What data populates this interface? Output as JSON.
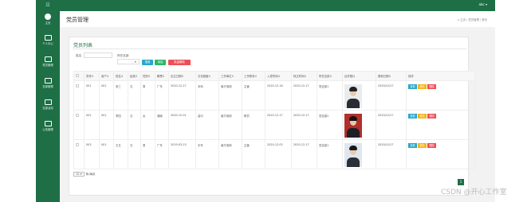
{
  "sidebar": {
    "logo": "☷",
    "items": [
      {
        "label": "主页",
        "icon": "home-icon"
      },
      {
        "label": "个人中心",
        "icon": "monitor-icon"
      },
      {
        "label": "党员管理",
        "icon": "monitor-icon"
      },
      {
        "label": "支部管理",
        "icon": "monitor-icon"
      },
      {
        "label": "支部活动",
        "icon": "monitor-icon"
      },
      {
        "label": "公告管理",
        "icon": "monitor-icon"
      }
    ]
  },
  "topbar": {
    "user": "abc ▾"
  },
  "header": {
    "title": "党员管理",
    "breadcrumb": "⌂ 主页  /  党员管理  /  首页"
  },
  "panel": {
    "title": "党员列表",
    "filters": {
      "name_label": "姓名",
      "branch_label": "所在支部",
      "select_value": "▾"
    },
    "buttons": {
      "search": "搜索",
      "add": "添加",
      "batch_delete": "批量删除"
    }
  },
  "table": {
    "headers": [
      "",
      "党号⇕",
      "用户⇕",
      "姓名⇕",
      "民族⇕",
      "性别⇕",
      "籍贯⇕",
      "出生日期⇕",
      "文化程度⇕",
      "工作单位⇕",
      "工作职务⇕",
      "入党时间⇕",
      "转正时间⇕",
      "所在支部⇕",
      "证件照片",
      "更新日期⇕",
      "操作"
    ],
    "rows": [
      {
        "cells": [
          "001",
          "001",
          "张三",
          "汉",
          "男",
          "广东",
          "2020-12-17",
          "本科",
          "南方电网",
          "主管",
          "2020-12-16",
          "2020-12-17",
          "党支部1"
        ],
        "updated": "2020/12/17",
        "photo": {
          "bg": "#e9ecef",
          "hair": "#222",
          "body": "#2b2b33"
        }
      },
      {
        "cells": [
          "002",
          "001",
          "李四",
          "汉",
          "女",
          "湖南",
          "2020-12-01",
          "高中",
          "南方电网",
          "职员",
          "2020-12-17",
          "2020-12-17",
          "党支部2"
        ],
        "updated": "2020/12/17",
        "photo": {
          "bg": "#b0302c",
          "hair": "#1b1010",
          "body": "#1f1f26"
        }
      },
      {
        "cells": [
          "003",
          "001",
          "王五",
          "汉",
          "男",
          "广东",
          "2019-03-13",
          "中专",
          "南方电网",
          "主管",
          "2020-12-02",
          "2020-12-17",
          "党支部1"
        ],
        "updated": "2020/12/17",
        "photo": {
          "bg": "#dfe6ee",
          "hair": "#1a1a1a",
          "body": "#2a2f3a"
        }
      }
    ],
    "actions": {
      "view": "查看",
      "edit": "修改",
      "delete": "删除"
    }
  },
  "pager": {
    "size": "10 ▾",
    "size_suffix": "条/每页",
    "page": "1"
  },
  "watermark": "CSDN @开心工作室",
  "colors": {
    "primary": "#1e6e46",
    "search": "#2aa7c9",
    "add": "#2eb868",
    "danger": "#ef4e56",
    "edit": "#f5b21a"
  }
}
